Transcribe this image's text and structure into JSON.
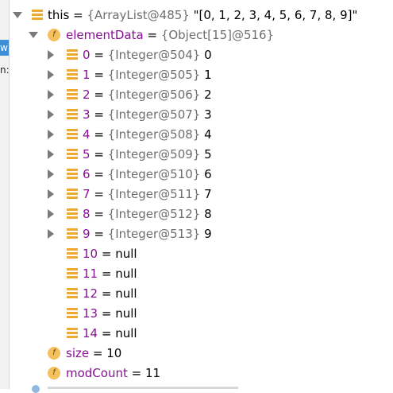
{
  "left_strip": {
    "tab_text": "w",
    "label_text": "n:"
  },
  "root": {
    "name": "this",
    "eq": " = ",
    "type": "{ArrayList@485}",
    "value": " \"[0, 1, 2, 3, 4, 5, 6, 7, 8, 9]\""
  },
  "elementData": {
    "name": "elementData",
    "eq": " = ",
    "type": "{Object[15]@516}"
  },
  "items": [
    {
      "index": "0",
      "eq": " = ",
      "type": "{Integer@504}",
      "value": " 0"
    },
    {
      "index": "1",
      "eq": " = ",
      "type": "{Integer@505}",
      "value": " 1"
    },
    {
      "index": "2",
      "eq": " = ",
      "type": "{Integer@506}",
      "value": " 2"
    },
    {
      "index": "3",
      "eq": " = ",
      "type": "{Integer@507}",
      "value": " 3"
    },
    {
      "index": "4",
      "eq": " = ",
      "type": "{Integer@508}",
      "value": " 4"
    },
    {
      "index": "5",
      "eq": " = ",
      "type": "{Integer@509}",
      "value": " 5"
    },
    {
      "index": "6",
      "eq": " = ",
      "type": "{Integer@510}",
      "value": " 6"
    },
    {
      "index": "7",
      "eq": " = ",
      "type": "{Integer@511}",
      "value": " 7"
    },
    {
      "index": "8",
      "eq": " = ",
      "type": "{Integer@512}",
      "value": " 8"
    },
    {
      "index": "9",
      "eq": " = ",
      "type": "{Integer@513}",
      "value": " 9"
    }
  ],
  "null_items": [
    {
      "index": "10",
      "eq": " = ",
      "value": "null"
    },
    {
      "index": "11",
      "eq": " = ",
      "value": "null"
    },
    {
      "index": "12",
      "eq": " = ",
      "value": "null"
    },
    {
      "index": "13",
      "eq": " = ",
      "value": "null"
    },
    {
      "index": "14",
      "eq": " = ",
      "value": "null"
    }
  ],
  "size": {
    "name": "size",
    "eq": " = ",
    "value": "10"
  },
  "modCount": {
    "name": "modCount",
    "eq": " = ",
    "value": "11"
  },
  "colors": {
    "field_name": "#871094",
    "type_text": "#6e6e6e",
    "icon_orange": "#f0a930",
    "field_icon": "#f4c15e"
  },
  "icons": {
    "expanded": "triangle-down-icon",
    "collapsed": "triangle-right-icon",
    "object": "list-icon",
    "field": "field-icon"
  }
}
